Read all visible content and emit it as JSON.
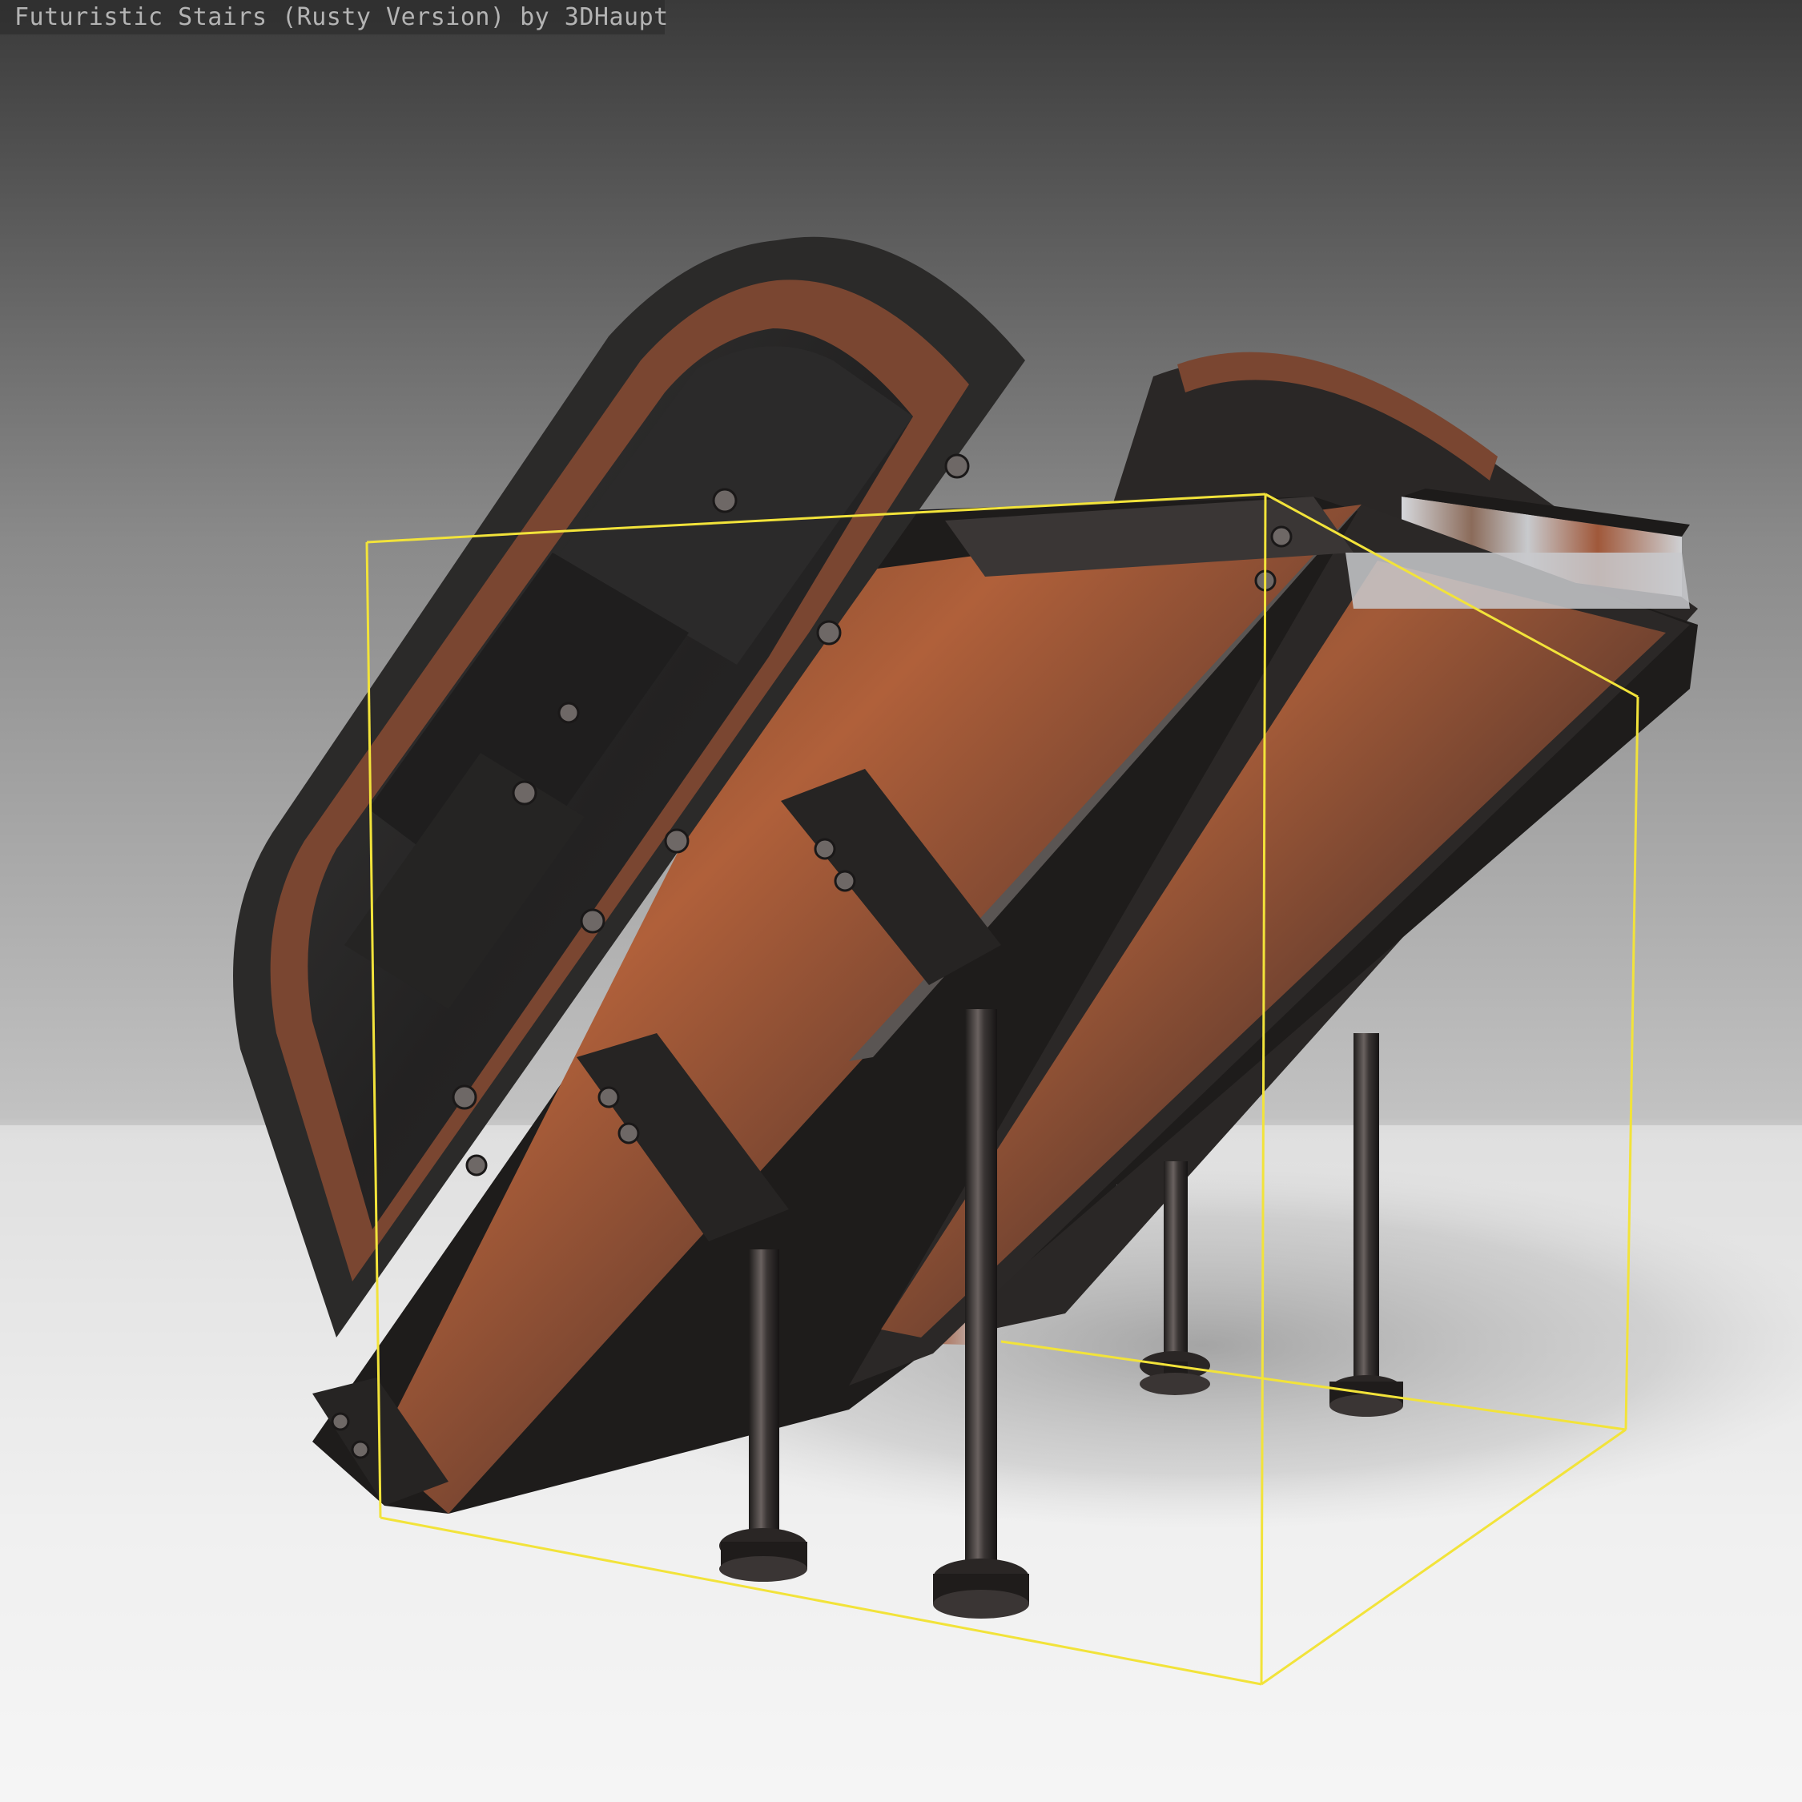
{
  "viewer": {
    "title": "Futuristic Stairs (Rusty Version) by 3DHaupt",
    "background_top": "#3b3b3b",
    "background_mid": "#b9b9b9",
    "floor_color": "#fbfbfb",
    "bounding_box_color": "#f2e33a",
    "metal_dark": "#2c2a29",
    "metal_mid": "#4a4745",
    "rust_color": "#b2613a",
    "steel_highlight": "#c9cbcf"
  }
}
